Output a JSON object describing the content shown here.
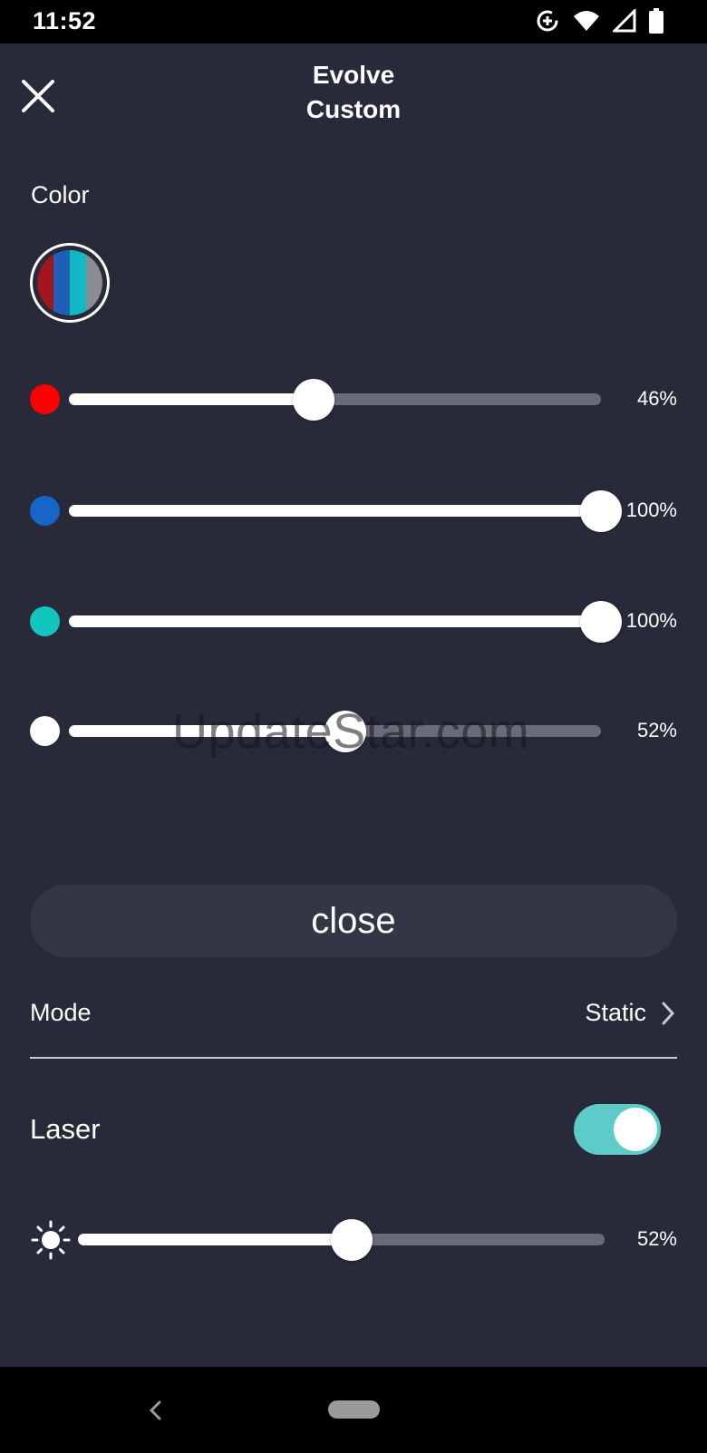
{
  "status_bar": {
    "time": "11:52",
    "icons": [
      "data-saver-icon",
      "wifi-icon",
      "signal-icon",
      "battery-icon"
    ]
  },
  "header": {
    "title_line1": "Evolve",
    "title_line2": "Custom",
    "close_icon": "close-icon"
  },
  "color_section": {
    "label": "Color",
    "swatch_colors": [
      "#a0161e",
      "#1f5fb7",
      "#11b9c2",
      "#8a8c93"
    ]
  },
  "channel_sliders": [
    {
      "name": "red",
      "dot_color": "#ff0000",
      "percent": 46,
      "value_label": "46%"
    },
    {
      "name": "blue",
      "dot_color": "#1666c7",
      "percent": 100,
      "value_label": "100%"
    },
    {
      "name": "cyan",
      "dot_color": "#12c6c0",
      "percent": 100,
      "value_label": "100%"
    },
    {
      "name": "white",
      "dot_color": "#ffffff",
      "percent": 52,
      "value_label": "52%"
    }
  ],
  "watermark": "UpdateStar.com",
  "close_button": {
    "label": "close"
  },
  "mode": {
    "label": "Mode",
    "value": "Static"
  },
  "laser": {
    "label": "Laser",
    "enabled": true,
    "toggle_color": "#5ecbc9"
  },
  "brightness": {
    "icon": "sun-icon",
    "percent": 52,
    "value_label": "52%"
  },
  "colors": {
    "background": "#282a39",
    "track_inactive": "#696b78",
    "accent": "#5ecbc9"
  }
}
